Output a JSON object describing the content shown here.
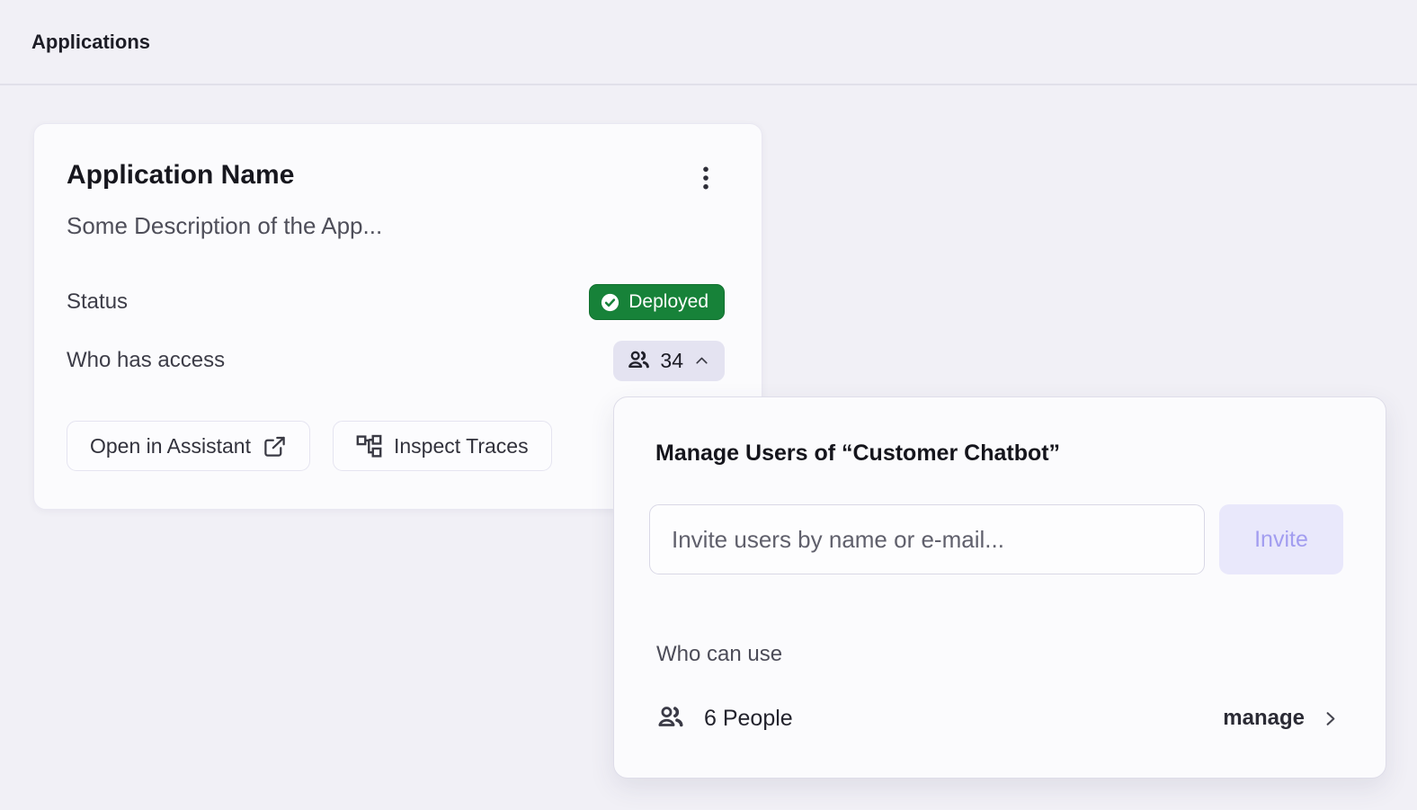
{
  "header": {
    "title": "Applications"
  },
  "app_card": {
    "name": "Application Name",
    "description": "Some Description of the App...",
    "status": {
      "label": "Status",
      "value": "Deployed"
    },
    "access": {
      "label": "Who has access",
      "count": "34"
    },
    "actions": {
      "open_in_assistant": "Open in Assistant",
      "inspect_traces": "Inspect Traces"
    }
  },
  "manage_popover": {
    "title": "Manage Users of “Customer Chatbot”",
    "invite": {
      "placeholder": "Invite users by name or e-mail...",
      "button_label": "Invite"
    },
    "who_can_use": {
      "label": "Who can use",
      "people_count": "6 People",
      "manage_label": "manage"
    }
  },
  "icons": {
    "kebab_menu": "vertical three-dot menu",
    "check_circle": "white circle with green checkmark",
    "users": "two-people silhouette",
    "chevron_up": "collapse caret",
    "chevron_right": "navigate caret",
    "external_link": "open in new window",
    "traces": "branching trace tree"
  },
  "colors": {
    "page_background": "#f1f0f6",
    "status_green": "#178239",
    "pill_background": "#e4e3f1",
    "invite_button_bg": "#e9e8fb",
    "invite_button_text": "#a29df0"
  }
}
